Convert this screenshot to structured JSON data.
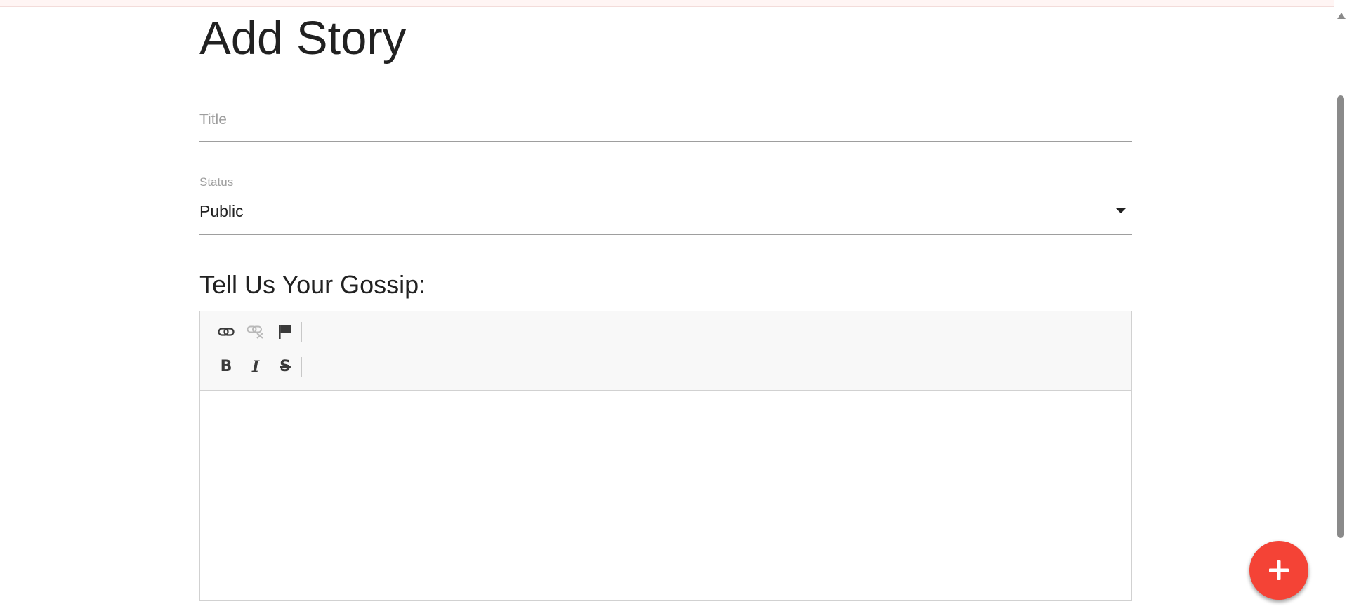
{
  "page": {
    "title": "Add Story"
  },
  "form": {
    "title_placeholder": "Title",
    "title_value": "",
    "status_label": "Status",
    "status_value": "Public",
    "body_heading": "Tell Us Your Gossip:"
  },
  "editor": {
    "toolbar_row1": [
      "link-icon",
      "unlink-icon",
      "anchor-flag-icon"
    ],
    "toolbar_row2": [
      {
        "name": "bold-button",
        "glyph": "B"
      },
      {
        "name": "italic-button",
        "glyph": "I"
      },
      {
        "name": "strikethrough-button",
        "glyph": "S"
      }
    ],
    "bold_glyph": "B",
    "italic_glyph": "I",
    "strike_glyph": "S",
    "content": ""
  },
  "fab": {
    "icon": "plus-icon",
    "color": "#f44336"
  },
  "colors": {
    "accent": "#f44336",
    "text": "#212121",
    "muted": "#9e9e9e",
    "toolbar_bg": "#f8f8f8"
  }
}
